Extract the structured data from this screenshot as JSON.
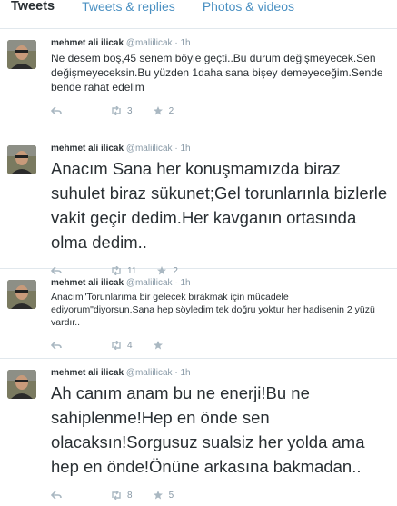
{
  "tabs": [
    {
      "label": "Tweets"
    },
    {
      "label": "Tweets & replies"
    },
    {
      "label": "Photos & videos"
    }
  ],
  "tweets": [
    {
      "name": "mehmet ali ilicak",
      "handle": "@maliilicak",
      "dot": "·",
      "time": "1h",
      "text": "Ne desem boş,45 senem böyle geçti..Bu durum değişmeyecek.Sen değişmeyeceksin.Bu yüzden 1daha sana bişey demeyeceğim.Sende bende rahat edelim",
      "retweets": "3",
      "favorites": "2"
    },
    {
      "name": "mehmet ali ilicak",
      "handle": "@maliilicak",
      "dot": "·",
      "time": "1h",
      "text": "Anacım Sana her konuşmamızda biraz suhulet biraz sükunet;Gel torunlarınla bizlerle vakit geçir dedim.Her kavganın ortasında olma dedim..",
      "retweets": "11",
      "favorites": "2"
    },
    {
      "name": "mehmet ali ilicak",
      "handle": "@maliilicak",
      "dot": "·",
      "time": "1h",
      "text": "Anacım\"Torunlarıma bir gelecek bırakmak için mücadele ediyorum\"diyorsun.Sana hep söyledim tek doğru yoktur her hadisenin 2 yüzü vardır..",
      "retweets": "4",
      "favorites": ""
    },
    {
      "name": "mehmet ali ilicak",
      "handle": "@maliilicak",
      "dot": "·",
      "time": "1h",
      "text": "Ah canım anam bu ne enerji!Bu ne sahiplenme!Hep en önde sen olacaksın!Sorgusuz sualsiz her yolda ama hep en önde!Önüne arkasına bakmadan..",
      "retweets": "8",
      "favorites": "5"
    }
  ],
  "icons": {
    "reply": "reply-icon",
    "retweet": "retweet-icon",
    "favorite": "star-icon"
  },
  "colors": {
    "muted": "#8899a6",
    "link": "#4a90c2",
    "text": "#292f33",
    "divider": "#e1e8ed"
  }
}
